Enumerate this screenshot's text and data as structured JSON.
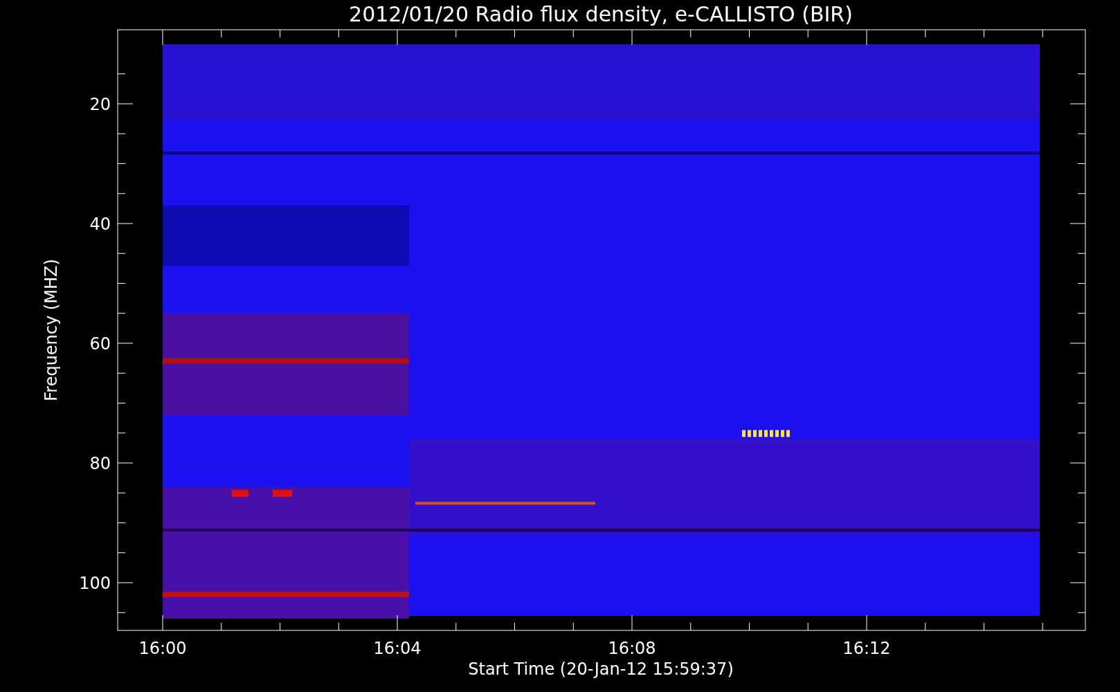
{
  "title": "2012/01/20  Radio flux density, e-CALLISTO (BIR)",
  "y_axis": {
    "label": "Frequency (MHZ)",
    "ticks": [
      "20",
      "40",
      "60",
      "80",
      "100"
    ]
  },
  "x_axis": {
    "label": "Start Time (20-Jan-12 15:59:37)",
    "ticks": [
      "16:00",
      "16:04",
      "16:08",
      "16:12"
    ]
  }
}
